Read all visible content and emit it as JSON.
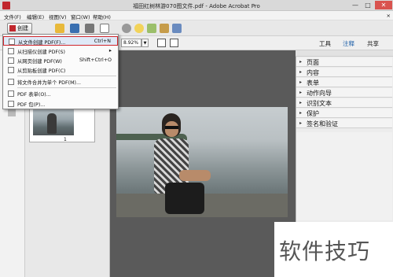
{
  "window": {
    "title": "福田红树林游070图文件.pdf - Adobe Acrobat Pro",
    "minimize": "—",
    "maximize": "□",
    "close": "✕"
  },
  "menu": [
    "文件(F)",
    "编辑(E)",
    "视图(V)",
    "窗口(W)",
    "帮助(H)"
  ],
  "menu_close": "×",
  "toolbar": {
    "create_label": "创建"
  },
  "view_toolbar": {
    "zoom": "8.92%",
    "tabs": [
      "工具",
      "注释",
      "共享"
    ]
  },
  "create_menu": [
    {
      "label": "从文件创建 PDF(F)...",
      "shortcut": "Ctrl+N"
    },
    {
      "label": "从扫描仪创建 PDF(S)",
      "shortcut": "▸"
    },
    {
      "label": "从网页创建 PDF(W)",
      "shortcut": "Shift+Ctrl+O"
    },
    {
      "label": "从剪贴板创建 PDF(C)",
      "shortcut": ""
    },
    {
      "label": "将文件合并为单个 PDF(M)...",
      "shortcut": ""
    },
    {
      "label": "PDF 表单(O)...",
      "shortcut": ""
    },
    {
      "label": "PDF 包(P)...",
      "shortcut": ""
    }
  ],
  "thumbnail": {
    "page_number": "1"
  },
  "right_panel": [
    "页面",
    "内容",
    "表单",
    "动作向导",
    "识别文本",
    "保护",
    "签名和验证"
  ],
  "watermark": "软件技巧"
}
